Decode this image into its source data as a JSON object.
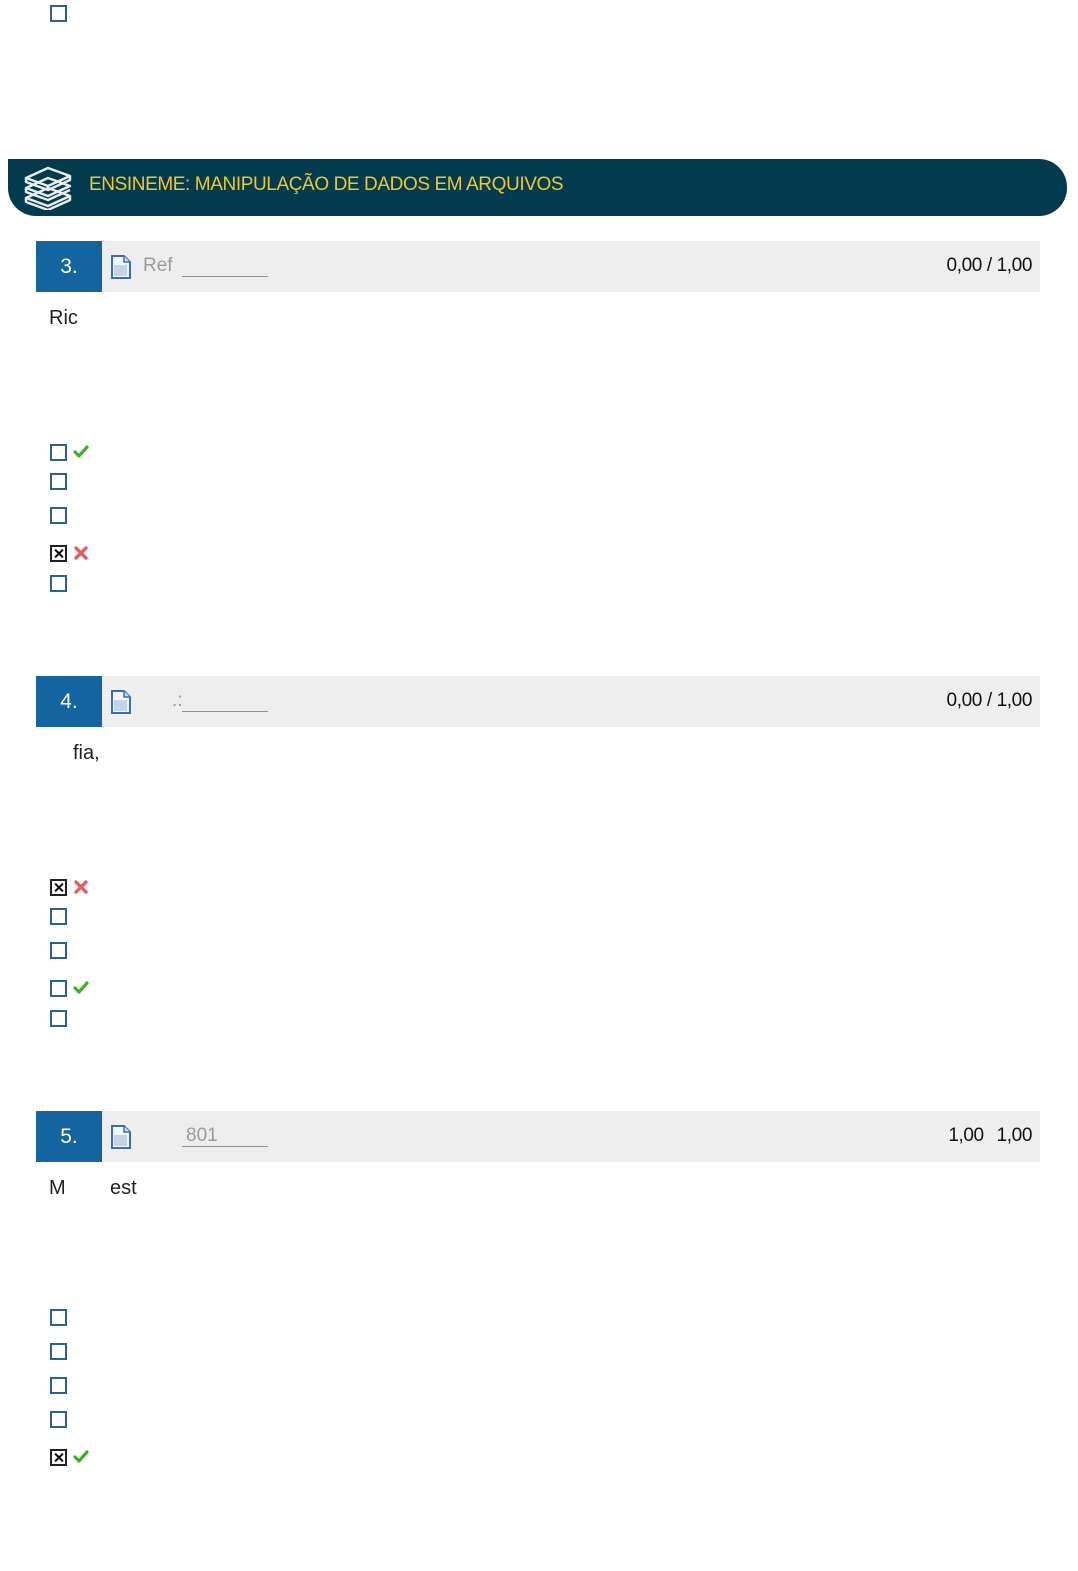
{
  "section": {
    "title": "ENSINEME: MANIPULAÇÃO DE DADOS EM ARQUIVOS",
    "icon": "books-stack-icon"
  },
  "questions": [
    {
      "number": "3.",
      "ref_label": "Ref",
      "score": "0,00",
      "score_sep": "/",
      "score_max": "1,00",
      "text": "Ric",
      "options": [
        {
          "checked": false,
          "mark": "correct"
        },
        {
          "checked": false,
          "mark": ""
        },
        {
          "checked": false,
          "mark": ""
        },
        {
          "checked": true,
          "mark": "wrong"
        },
        {
          "checked": false,
          "mark": ""
        }
      ]
    },
    {
      "number": "4.",
      "ref_label": ".:",
      "score": "0,00",
      "score_sep": "/",
      "score_max": "1,00",
      "text": "fia,",
      "options": [
        {
          "checked": true,
          "mark": "wrong"
        },
        {
          "checked": false,
          "mark": ""
        },
        {
          "checked": false,
          "mark": ""
        },
        {
          "checked": false,
          "mark": "correct"
        },
        {
          "checked": false,
          "mark": ""
        }
      ]
    },
    {
      "number": "5.",
      "ref_label": "801",
      "score": "1,00",
      "score_sep": "",
      "score_max": "1,00",
      "text_a": "M",
      "text_b": "est",
      "options": [
        {
          "checked": false,
          "mark": ""
        },
        {
          "checked": false,
          "mark": ""
        },
        {
          "checked": false,
          "mark": ""
        },
        {
          "checked": false,
          "mark": ""
        },
        {
          "checked": true,
          "mark": "correct"
        }
      ]
    }
  ],
  "colors": {
    "section_bg": "#033a4d",
    "section_text": "#f2c62e",
    "qnum_bg": "#1464a0",
    "correct": "#3fae29",
    "wrong": "#e0606a"
  }
}
